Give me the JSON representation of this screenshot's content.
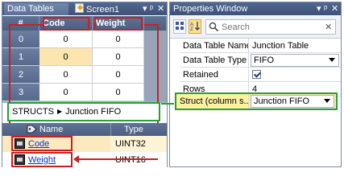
{
  "left_panel": {
    "tabs": [
      {
        "label": "Data Tables"
      },
      {
        "label": "Screen1"
      }
    ],
    "grid": {
      "corner": "#",
      "columns": [
        "Code",
        "Weight"
      ],
      "rows": [
        {
          "index": "0",
          "values": [
            "0",
            "0"
          ]
        },
        {
          "index": "1",
          "values": [
            "0",
            "0"
          ]
        },
        {
          "index": "2",
          "values": [
            "0",
            "0"
          ]
        },
        {
          "index": "3",
          "values": [
            "0",
            "0"
          ]
        }
      ]
    },
    "breadcrumb": {
      "root": "STRUCTS",
      "item": "Junction FIFO"
    },
    "members": {
      "headers": {
        "name": "Name",
        "type": "Type"
      },
      "rows": [
        {
          "name": "Code",
          "type": "UINT32"
        },
        {
          "name": "Weight",
          "type": "UINT16"
        }
      ]
    }
  },
  "properties": {
    "title": "Properties Window",
    "search_placeholder": "Search",
    "rows": [
      {
        "label": "Data Table Name",
        "value": "Junction Table"
      },
      {
        "label": "Data Table Type",
        "value": "FIFO"
      },
      {
        "label": "Retained",
        "value": ""
      },
      {
        "label": "Rows",
        "value": "4"
      },
      {
        "label": "Struct (column s...",
        "value": "Junction FIFO"
      }
    ]
  },
  "colors": {
    "highlight_red": "#cc1f1f",
    "highlight_green": "#27a035",
    "selected_cell": "#fde5b0",
    "struct_row": "#fbf2a0"
  }
}
